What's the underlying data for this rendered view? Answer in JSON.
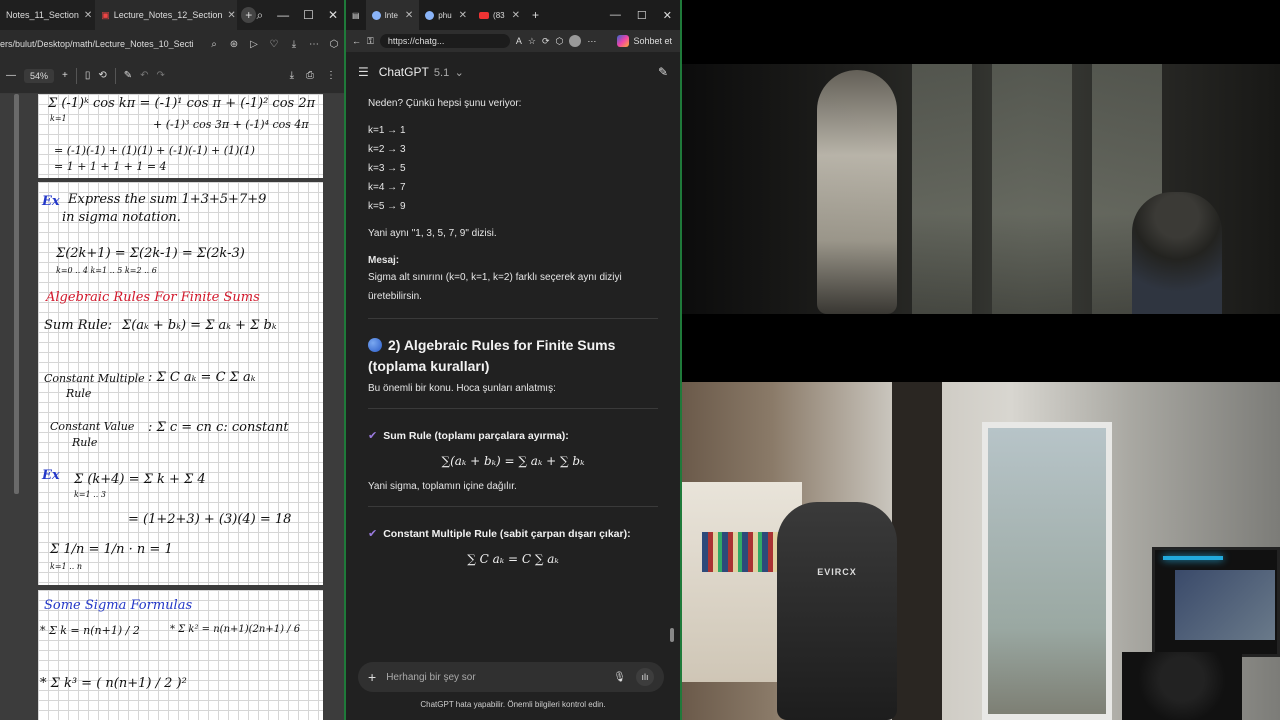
{
  "pdf": {
    "tabs": [
      {
        "label": "Notes_11_Section"
      },
      {
        "label": "Lecture_Notes_12_Section"
      }
    ],
    "address": "ers/bulut/Desktop/math/Lecture_Notes_10_Secti",
    "zoom": "54%",
    "page1": {
      "l1": "Σ (-1)ᵏ cos kπ = (-1)¹ cos π + (-1)² cos 2π",
      "l1b": "k=1",
      "l2": "+ (-1)³ cos 3π + (-1)⁴ cos 4π",
      "l3": "= (-1)(-1) + (1)(1) + (-1)(-1) + (1)(1)",
      "l4": "= 1 + 1 + 1 + 1 = 4"
    },
    "page2": {
      "ex_label": "Ex",
      "ex_line1": "Express the sum 1+3+5+7+9",
      "ex_line2": "in sigma notation.",
      "sigma_forms": "Σ(2k+1) = Σ(2k-1) = Σ(2k-3)",
      "sigma_limits": "k=0 .. 4     k=1 .. 5     k=2 .. 6",
      "heading": "Algebraic Rules For Finite Sums",
      "sum_rule_label": "Sum Rule:",
      "sum_rule": "Σ(aₖ + bₖ) = Σ aₖ + Σ bₖ",
      "const_mult_label": "Constant Multiple",
      "const_mult_rule": "Rule",
      "const_mult": ": Σ C aₖ = C Σ aₖ",
      "const_val_label": "Constant Value",
      "const_val_rule": "Rule",
      "const_val": ": Σ c = cn     c: constant",
      "ex2_label": "Ex",
      "ex2": "Σ (k+4) = Σ k + Σ 4",
      "ex2_limits": "k=1 .. 3",
      "ex2_result": "= (1+2+3) + (3)(4) = 18",
      "ex3": "Σ 1/n = 1/n · n = 1",
      "ex3_limits": "k=1 .. n"
    },
    "page3": {
      "heading": "Some Sigma Formulas",
      "f1": "* Σ k = n(n+1) / 2",
      "f2": "* Σ k² = n(n+1)(2n+1) / 6",
      "f3": "* Σ k³ = ( n(n+1) / 2 )²"
    }
  },
  "chat": {
    "tabs": [
      {
        "label": "Inte"
      },
      {
        "label": "phu"
      },
      {
        "label": "(83"
      }
    ],
    "url": "https://chatg...",
    "copilot_label": "Sohbet et",
    "model_name": "ChatGPT",
    "model_version": "5.1",
    "msg_intro": "Neden? Çünkü hepsi şunu veriyor:",
    "mapping": [
      "k=1 → 1",
      "k=2 → 3",
      "k=3 → 5",
      "k=4 → 7",
      "k=5 → 9"
    ],
    "same_sequence": "Yani aynı \"1, 3, 5, 7, 9\" dizisi.",
    "message_label": "Mesaj:",
    "message_text": "Sigma alt sınırını (k=0, k=1, k=2) farklı seçerek aynı diziyi üretebilirsin.",
    "section_title": "2) Algebraic Rules for Finite Sums (toplama kuralları)",
    "section_intro": "Bu önemli bir konu. Hoca şunları anlatmış:",
    "sum_rule_title": "Sum Rule (toplamı parçalara ayırma):",
    "sum_rule_formula": "∑(aₖ + bₖ) = ∑ aₖ + ∑ bₖ",
    "sum_rule_note": "Yani sigma, toplamın içine dağılır.",
    "const_rule_title": "Constant Multiple Rule (sabit çarpan dışarı çıkar):",
    "const_rule_formula": "∑ C aₖ = C ∑ aₖ",
    "input_placeholder": "Herhangi bir şey sor",
    "disclaimer": "ChatGPT hata yapabilir. Önemli bilgileri kontrol edin."
  },
  "video": {
    "chair_brand": "EVIRCX"
  },
  "colors": {
    "accent_green": "#1f7a3a",
    "check_purple": "#9b7be0",
    "ink_red": "#d2182b",
    "ink_blue": "#2438c8"
  }
}
